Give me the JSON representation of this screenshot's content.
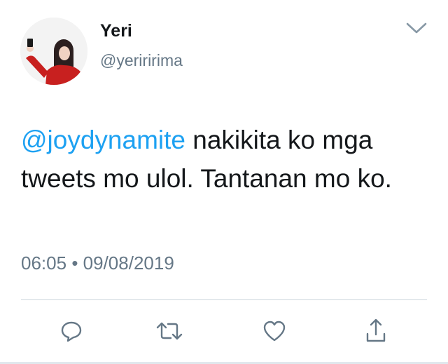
{
  "user": {
    "name": "Yeri",
    "handle": "@yeriririma"
  },
  "tweet": {
    "mention": "@joydynamite",
    "text": " nakikita ko mga tweets mo ulol. Tantanan mo ko.",
    "time": "06:05",
    "separator": "•",
    "date": "09/08/2019"
  },
  "icons": {
    "caret": "chevron-down-icon",
    "reply": "reply-icon",
    "retweet": "retweet-icon",
    "like": "like-icon",
    "share": "share-icon"
  },
  "colors": {
    "mention": "#1da1f2",
    "secondary_text": "#657786",
    "icon": "#657786"
  }
}
